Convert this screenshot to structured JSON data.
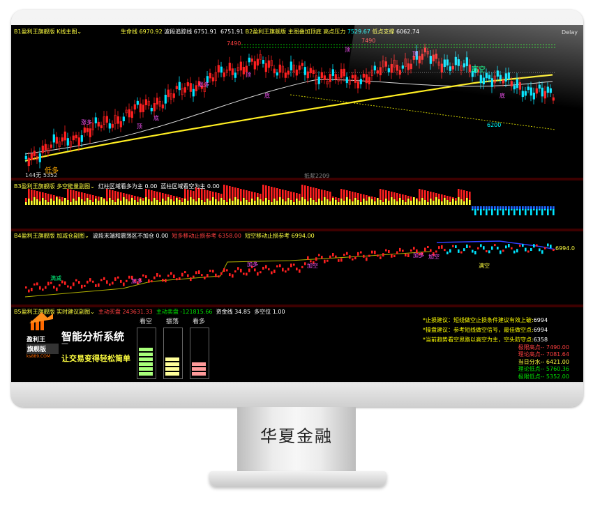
{
  "brand": "华夏金融",
  "header": {
    "panel": "B1盈利王旗舰版 K线主图",
    "ma1_label": "生命线",
    "ma1_value": "6970.92",
    "ma2_label": "波段追踪线",
    "ma2_value": "6751.91",
    "ma3_value": "6751.91",
    "overlay": "B2盈利王旗舰版 主图叠加顶底",
    "high_label": "高点压力",
    "high_value": "7529.67",
    "low_label": "低点支撑",
    "low_value": "6062.74",
    "right": "Delay"
  },
  "main_chart": {
    "peak_label": "7490",
    "low_label": "6200",
    "bottom_label": "144无",
    "bottom_value": "5352",
    "center_label": "抵浆2209",
    "signals": [
      "涨多",
      "顶",
      "顶",
      "底",
      "顶",
      "顶",
      "底",
      "顶",
      "顶",
      "底",
      "低多",
      "高空"
    ]
  },
  "b3": {
    "panel": "B3盈利王旗舰版 多空能量副图",
    "text1": "红柱区域看多为主",
    "v1": "0.00",
    "text2": "蓝柱区域看空为主",
    "v2": "0.00"
  },
  "b4": {
    "panel": "B4盈利王旗舰版 加减仓副图",
    "text1": "波段末端和震荡区不加仓",
    "v1": "0.00",
    "text2": "短多移动止损参考",
    "v2": "6358.00",
    "text3": "短空移动止损参考",
    "v3": "6994.00",
    "right_value": "6994.0",
    "signals": [
      "满减",
      "加多",
      "加多",
      "加空",
      "加多",
      "加空",
      "满空"
    ]
  },
  "b5": {
    "panel": "B5盈利王旗舰版 实时建议副图",
    "buy_label": "主动买盘",
    "buy_value": "243631.33",
    "sell_label": "主动卖盘",
    "sell_value": "-121815.66",
    "fund_label": "资金线",
    "fund_value": "34.85",
    "pos_label": "多空位",
    "pos_value": "1.00"
  },
  "logo": {
    "title": "智能分析系统",
    "slogan": "让交易变得轻松简单",
    "badge_line1": "盈利王",
    "badge_line2": "旗舰版",
    "badge_url": "ks889.COM"
  },
  "meters": [
    {
      "label": "看空",
      "color": "#a8ff7a"
    },
    {
      "label": "振荡",
      "color": "#ffff99"
    },
    {
      "label": "看多",
      "color": "#ff9a9a"
    }
  ],
  "advice": [
    {
      "text": "*止损建议：短线做空止损条件建议有效上破:",
      "value": "6994"
    },
    {
      "text": "*操盘建议：参考短线做空信号，最佳做空点:",
      "value": "6994"
    },
    {
      "text": "*当前趋势看空思路以高空为主，空头防守点:",
      "value": "6358"
    }
  ],
  "levels": [
    {
      "label": "极限高点--",
      "value": "7490.00",
      "color": "#ff4040"
    },
    {
      "label": "理论高点--",
      "value": "7081.64",
      "color": "#ff4040"
    },
    {
      "label": "当日分水--",
      "value": "6421.00",
      "color": "#ffff00"
    },
    {
      "label": "理论低点--",
      "value": "5760.36",
      "color": "#00e000"
    },
    {
      "label": "极限低点--",
      "value": "5352.00",
      "color": "#00e000"
    }
  ],
  "colors": {
    "up": "#ff2020",
    "down": "#00e5ff",
    "ma_yellow": "#ffee22",
    "ma_white": "#dddddd"
  }
}
